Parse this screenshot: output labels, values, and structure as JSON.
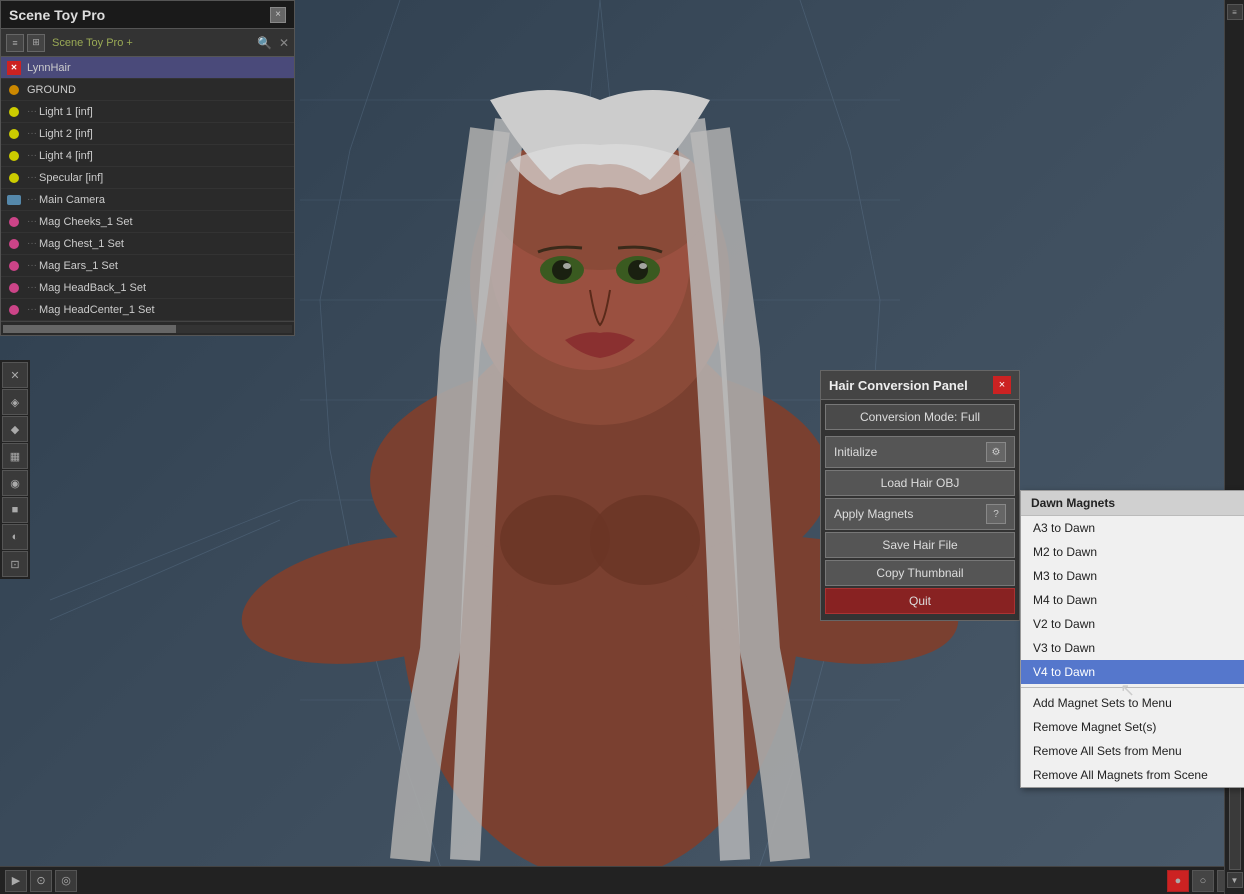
{
  "app": {
    "title": "Scene Toy Pro",
    "window_title": "Scene Toy Pro"
  },
  "scene_panel": {
    "title": "Scene Toy Pro",
    "path_label": "Scene Toy Pro +",
    "close_label": "×",
    "items": [
      {
        "id": "lynnhair",
        "label": "LynnHair",
        "icon_type": "red-x",
        "dots": "",
        "selected": true
      },
      {
        "id": "ground",
        "label": "GROUND",
        "icon_type": "orange-dot",
        "dots": ""
      },
      {
        "id": "light1",
        "label": "Light 1 [inf]",
        "icon_type": "yellow-dot",
        "dots": "···"
      },
      {
        "id": "light2",
        "label": "Light 2 [inf]",
        "icon_type": "yellow-dot",
        "dots": "···"
      },
      {
        "id": "light4",
        "label": "Light 4 [inf]",
        "icon_type": "yellow-dot",
        "dots": "···"
      },
      {
        "id": "specular",
        "label": "Specular [inf]",
        "icon_type": "yellow-dot",
        "dots": "···"
      },
      {
        "id": "maincamera",
        "label": "Main Camera",
        "icon_type": "camera",
        "dots": "···"
      },
      {
        "id": "magcheeks",
        "label": "Mag Cheeks_1 Set",
        "icon_type": "pink-dot",
        "dots": "···"
      },
      {
        "id": "magchest",
        "label": "Mag Chest_1 Set",
        "icon_type": "pink-dot",
        "dots": "···"
      },
      {
        "id": "magears",
        "label": "Mag Ears_1 Set",
        "icon_type": "pink-dot",
        "dots": "···"
      },
      {
        "id": "magheadback",
        "label": "Mag HeadBack_1 Set",
        "icon_type": "pink-dot",
        "dots": "···"
      },
      {
        "id": "magheadcenter",
        "label": "Mag HeadCenter_1 Set",
        "icon_type": "pink-dot",
        "dots": "···"
      }
    ]
  },
  "hair_panel": {
    "title": "Hair Conversion Panel",
    "close_label": "×",
    "conversion_mode_label": "Conversion Mode: Full",
    "initialize_label": "Initialize",
    "load_hair_obj_label": "Load Hair OBJ",
    "apply_magnets_label": "Apply Magnets",
    "save_hair_file_label": "Save Hair File",
    "copy_thumbnail_label": "Copy Thumbnail",
    "quit_label": "Quit"
  },
  "dawn_magnets": {
    "header": "Dawn Magnets",
    "items": [
      {
        "id": "a3-to-dawn",
        "label": "A3 to Dawn",
        "highlighted": false
      },
      {
        "id": "m2-to-dawn",
        "label": "M2 to Dawn",
        "highlighted": false
      },
      {
        "id": "m3-to-dawn",
        "label": "M3 to Dawn",
        "highlighted": false
      },
      {
        "id": "m4-to-dawn",
        "label": "M4 to Dawn",
        "highlighted": false
      },
      {
        "id": "v2-to-dawn",
        "label": "V2 to Dawn",
        "highlighted": false
      },
      {
        "id": "v3-to-dawn",
        "label": "V3 to Dawn",
        "highlighted": false
      },
      {
        "id": "v4-to-dawn",
        "label": "V4 to Dawn",
        "highlighted": true
      }
    ],
    "divider_items": [
      {
        "id": "add-magnet-sets",
        "label": "Add Magnet Sets to Menu"
      },
      {
        "id": "remove-magnet-set",
        "label": "Remove Magnet Set(s)"
      },
      {
        "id": "remove-all-sets",
        "label": "Remove All Sets from Menu"
      },
      {
        "id": "remove-all-magnets",
        "label": "Remove All Magnets from Scene"
      }
    ]
  },
  "left_tools": {
    "icons": [
      "✕",
      "◈",
      "◆",
      "▦",
      "◉",
      "■",
      "◐",
      "⊡"
    ]
  },
  "bottom_toolbar": {
    "icons": [
      "▶",
      "⊙",
      "◎"
    ]
  }
}
